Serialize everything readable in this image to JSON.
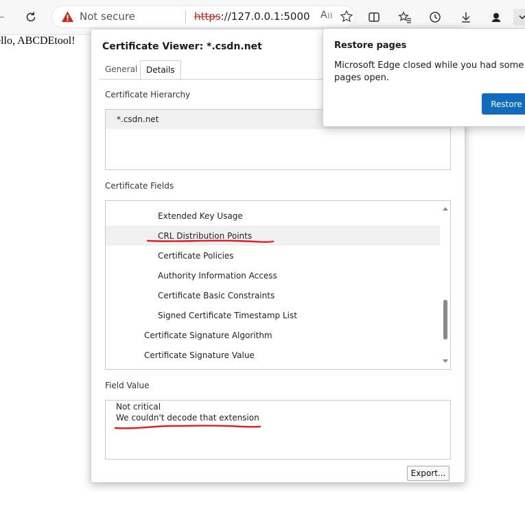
{
  "browser": {
    "security_label": "Not secure",
    "url_protocol": "https",
    "url_rest": "://127.0.0.1:5000",
    "accent_warning": "#c42b1c"
  },
  "page": {
    "text": "ello, ABCDEtool!"
  },
  "dialog": {
    "title": "Certificate Viewer: *.csdn.net",
    "tabs": [
      {
        "label": "General",
        "selected": false
      },
      {
        "label": "Details",
        "selected": true
      }
    ],
    "hierarchy_label": "Certificate Hierarchy",
    "hierarchy_items": [
      "*.csdn.net"
    ],
    "fields_label": "Certificate Fields",
    "fields": [
      {
        "label": "Extended Key Usage",
        "level": 2,
        "selected": false
      },
      {
        "label": "CRL Distribution Points",
        "level": 2,
        "selected": true
      },
      {
        "label": "Certificate Policies",
        "level": 2,
        "selected": false
      },
      {
        "label": "Authority Information Access",
        "level": 2,
        "selected": false
      },
      {
        "label": "Certificate Basic Constraints",
        "level": 2,
        "selected": false
      },
      {
        "label": "Signed Certificate Timestamp List",
        "level": 2,
        "selected": false
      },
      {
        "label": "Certificate Signature Algorithm",
        "level": 1,
        "selected": false
      },
      {
        "label": "Certificate Signature Value",
        "level": 1,
        "selected": false
      }
    ],
    "field_value_label": "Field Value",
    "field_value_lines": [
      "Not critical",
      "We couldn't decode that extension"
    ],
    "export_label": "Export..."
  },
  "restore_popup": {
    "title": "Restore pages",
    "message": "Microsoft Edge closed while you had some pages open.",
    "button_label": "Restore",
    "accent": "#0f6cbd"
  },
  "annotations": {
    "color": "#e02020"
  }
}
